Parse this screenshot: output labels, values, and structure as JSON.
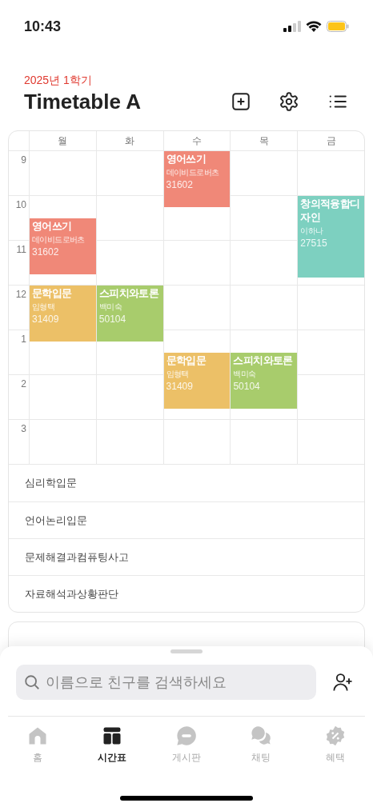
{
  "status_bar": {
    "time": "10:43"
  },
  "header": {
    "subtitle": "2025년 1학기",
    "title": "Timetable A"
  },
  "timetable": {
    "days": [
      "월",
      "화",
      "수",
      "목",
      "금"
    ],
    "hours": [
      "9",
      "10",
      "11",
      "12",
      "1",
      "2",
      "3"
    ],
    "events": [
      {
        "title": "영어쓰기",
        "lines": [
          "데이비드로버츠",
          "31602"
        ],
        "color": "#f08878"
      },
      {
        "title": "영어쓰기",
        "lines": [
          "데이비드로버츠",
          "31602"
        ],
        "color": "#f08878"
      },
      {
        "title": "창의적융합디자인",
        "lines": [
          "이하나",
          "27515"
        ],
        "color": "#7dd0c0"
      },
      {
        "title": "문학입문",
        "lines": [
          "임형택",
          "31409"
        ],
        "color": "#ecc067"
      },
      {
        "title": "스피치와토론",
        "lines": [
          "백미숙",
          "50104"
        ],
        "color": "#a8cc6c"
      },
      {
        "title": "문학입문",
        "lines": [
          "임형택",
          "31409"
        ],
        "color": "#ecc067"
      },
      {
        "title": "스피치와토론",
        "lines": [
          "백미숙",
          "50104"
        ],
        "color": "#a8cc6c"
      }
    ],
    "unscheduled": [
      "심리학입문",
      "언어논리입문",
      "문제해결과컴퓨팅사고",
      "자료해석과상황판단"
    ]
  },
  "friend_search": {
    "placeholder": "이름으로 친구를 검색하세요"
  },
  "tab_bar": [
    {
      "label": "홈",
      "selected": false
    },
    {
      "label": "시간표",
      "selected": true
    },
    {
      "label": "게시판",
      "selected": false
    },
    {
      "label": "채팅",
      "selected": false
    },
    {
      "label": "혜택",
      "selected": false
    }
  ]
}
